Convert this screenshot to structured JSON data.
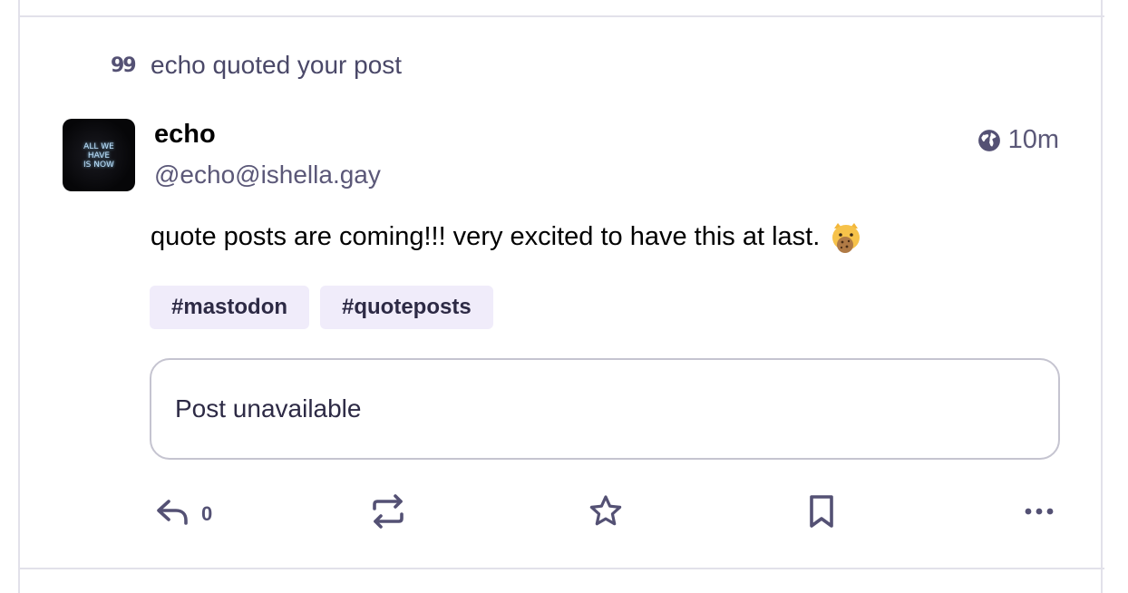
{
  "notification": {
    "icon": "quote-icon",
    "icon_glyph": "99",
    "text": "echo quoted your post"
  },
  "status": {
    "avatar_text": "ALL WE\nHAVE\nIS NOW",
    "display_name": "echo",
    "handle": "@echo@ishella.gay",
    "visibility_icon": "globe-icon",
    "time": "10m",
    "content": "quote posts are coming!!! very excited to have this at last.",
    "emoji": "cat-with-cookie-emoji",
    "hashtags": [
      "#mastodon",
      "#quoteposts"
    ],
    "quote": "Post unavailable"
  },
  "actions": {
    "reply_count": "0",
    "reply_icon": "reply-icon",
    "boost_icon": "boost-icon",
    "favourite_icon": "star-icon",
    "bookmark_icon": "bookmark-icon",
    "more_icon": "more-icon"
  },
  "colors": {
    "accent_icon": "#545174",
    "tag_bg": "#f0ecfa",
    "border": "#e2e1ea"
  }
}
